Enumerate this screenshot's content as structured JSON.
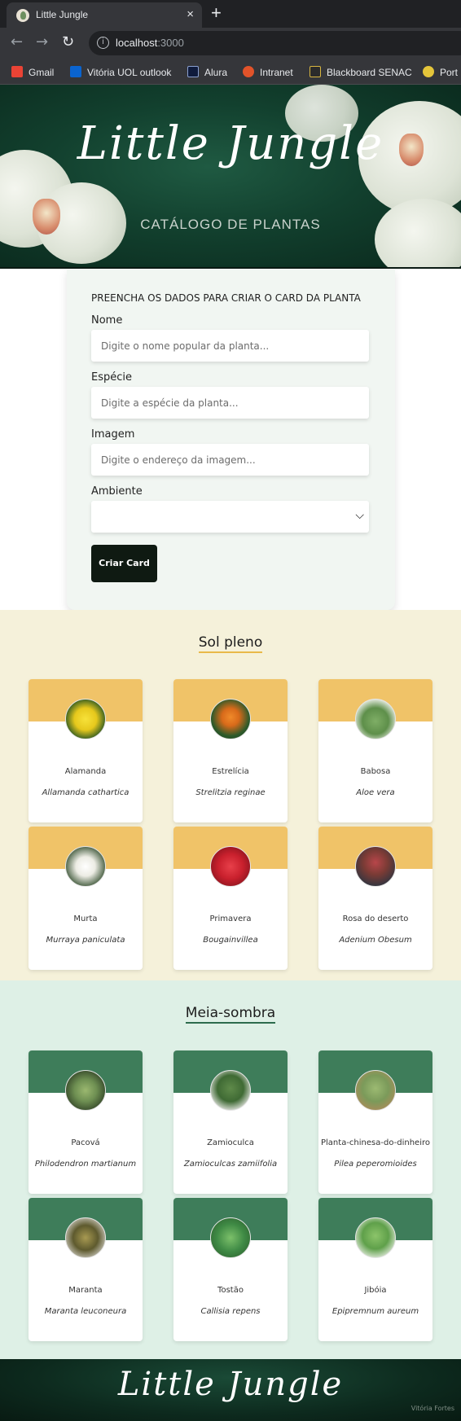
{
  "browser": {
    "tab_title": "Little Jungle",
    "tab_close": "×",
    "new_tab": "+",
    "back": "←",
    "forward": "→",
    "reload": "↻",
    "url_host": "localhost",
    "url_port": ":3000",
    "bookmarks": [
      {
        "label": "Gmail",
        "icon": "gmail-icon",
        "color": "#ea4335"
      },
      {
        "label": "Vitória UOL outlook",
        "icon": "outlook-icon",
        "color": "#0a64d0"
      },
      {
        "label": "Alura",
        "icon": "alura-icon",
        "color": "#0f1b3c"
      },
      {
        "label": "Intranet",
        "icon": "intranet-icon",
        "color": "#e2532a"
      },
      {
        "label": "Blackboard SENAC",
        "icon": "blackboard-icon",
        "color": "#d8b640"
      },
      {
        "label": "Port",
        "icon": "portal-icon",
        "color": "#e4c53a"
      }
    ]
  },
  "header": {
    "title": "Little Jungle",
    "subtitle": "CATÁLOGO DE PLANTAS"
  },
  "form": {
    "title": "PREENCHA OS DADOS PARA CRIAR O CARD DA PLANTA",
    "name_label": "Nome",
    "name_placeholder": "Digite o nome popular da planta...",
    "species_label": "Espécie",
    "species_placeholder": "Digite a espécie da planta...",
    "image_label": "Imagem",
    "image_placeholder": "Digite o endereço da imagem...",
    "env_label": "Ambiente",
    "env_value": "",
    "submit_label": "Criar Card"
  },
  "sections": [
    {
      "title": "Sol pleno",
      "accent": "#f0c368",
      "cards": [
        {
          "name": "Alamanda",
          "species": "Allamanda cathartica",
          "color": "#e6d21c",
          "icon": "yellow-flower-icon"
        },
        {
          "name": "Estrelícia",
          "species": "Strelitzia reginae",
          "color": "#e0782a",
          "icon": "bird-of-paradise-icon"
        },
        {
          "name": "Babosa",
          "species": "Aloe vera",
          "color": "#5e8f4a",
          "icon": "aloe-icon"
        },
        {
          "name": "Murta",
          "species": "Murraya paniculata",
          "color": "#f2f2ea",
          "icon": "white-flower-icon"
        },
        {
          "name": "Primavera",
          "species": "Bougainvillea",
          "color": "#c9202d",
          "icon": "red-flower-icon"
        },
        {
          "name": "Rosa do deserto",
          "species": "Adenium Obesum",
          "color": "#7a3b35",
          "icon": "desert-rose-icon"
        }
      ]
    },
    {
      "title": "Meia-sombra",
      "accent": "#3e7d5a",
      "cards": [
        {
          "name": "Pacová",
          "species": "Philodendron martianum",
          "color": "#6e8f52",
          "icon": "leaf-plant-icon"
        },
        {
          "name": "Zamioculca",
          "species": "Zamioculcas zamiifolia",
          "color": "#3f6a34",
          "icon": "zz-plant-icon"
        },
        {
          "name": "Planta-chinesa-do-dinheiro",
          "species": "Pilea peperomioides",
          "color": "#7b9a5a",
          "icon": "pilea-icon"
        },
        {
          "name": "Maranta",
          "species": "Maranta leuconeura",
          "color": "#5e5a2e",
          "icon": "maranta-icon"
        },
        {
          "name": "Tostão",
          "species": "Callisia repens",
          "color": "#3f8a45",
          "icon": "callisia-icon"
        },
        {
          "name": "Jibóia",
          "species": "Epipremnum aureum",
          "color": "#5fa04a",
          "icon": "pothos-icon"
        }
      ]
    }
  ],
  "footer": {
    "logo": "Little Jungle",
    "credit": "Vitória Fortes"
  }
}
